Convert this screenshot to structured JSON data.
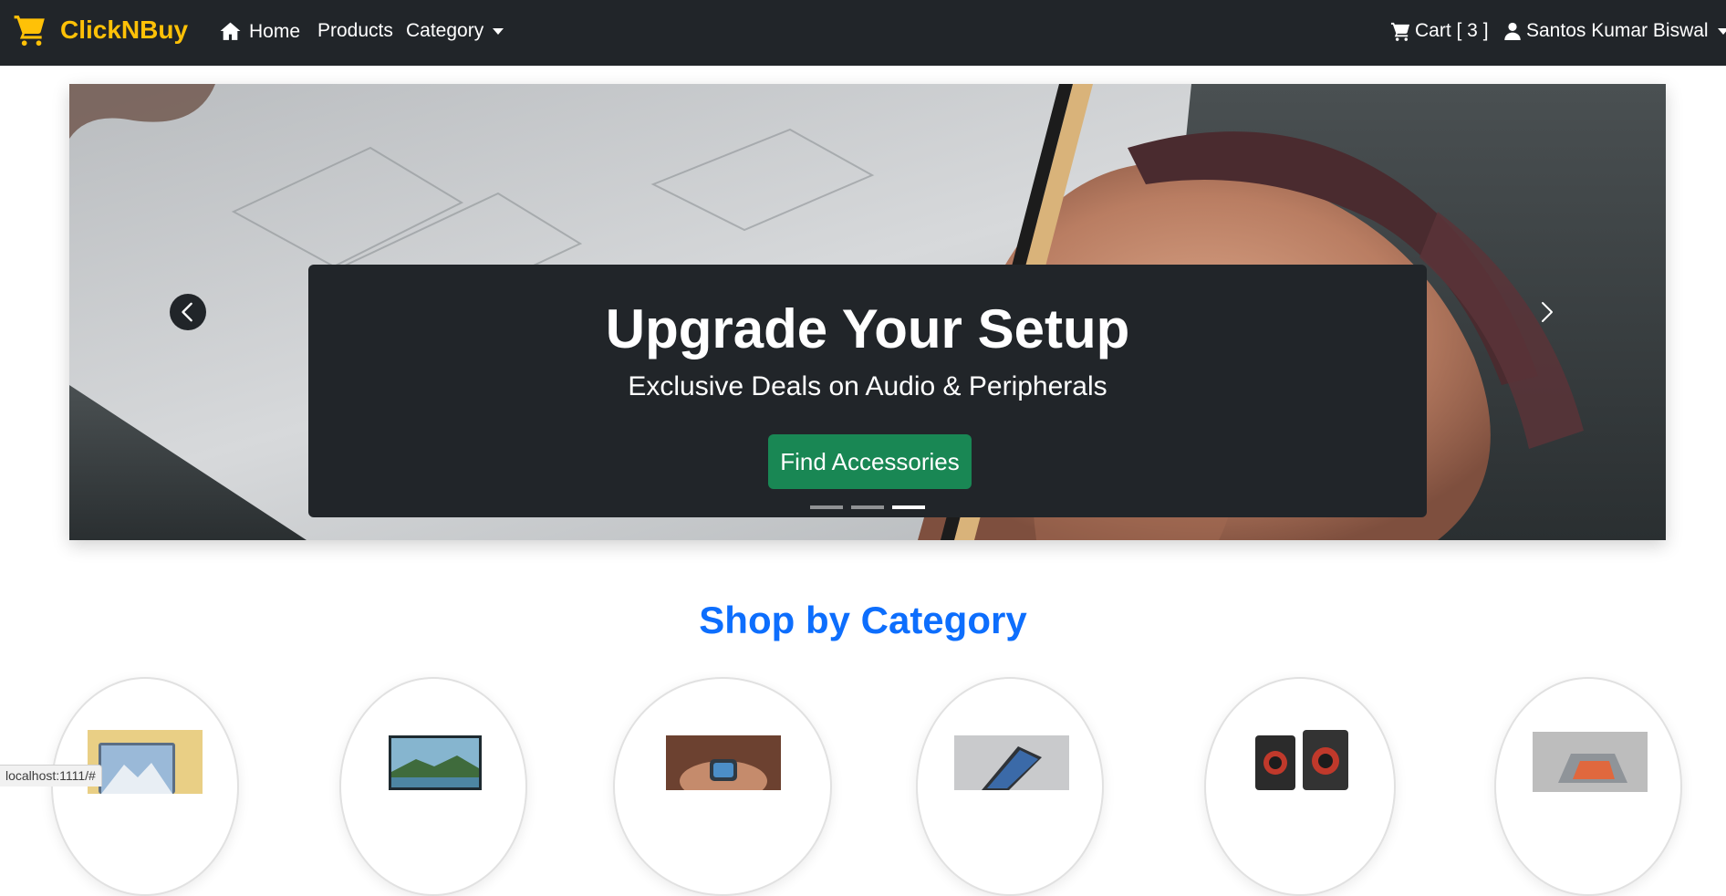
{
  "navbar": {
    "brand": "ClickNBuy",
    "home": "Home",
    "products": "Products",
    "category": "Category",
    "cart": "Cart [ 3 ]",
    "user": "Santos Kumar Biswal"
  },
  "carousel": {
    "title": "Upgrade Your Setup",
    "subtitle": "Exclusive Deals on Audio & Peripherals",
    "cta": "Find Accessories",
    "slides_count": 3,
    "active_slide": 3
  },
  "categories_section": {
    "title": "Shop by Category"
  },
  "status_bar": {
    "url": "localhost:1111/#"
  },
  "colors": {
    "navbar": "#212529",
    "brand": "#ffc107",
    "cta": "#198754",
    "section_title": "#0d6efd"
  },
  "icons": [
    "cart-icon",
    "home-icon",
    "user-icon",
    "chevron-left-icon",
    "chevron-right-icon"
  ]
}
